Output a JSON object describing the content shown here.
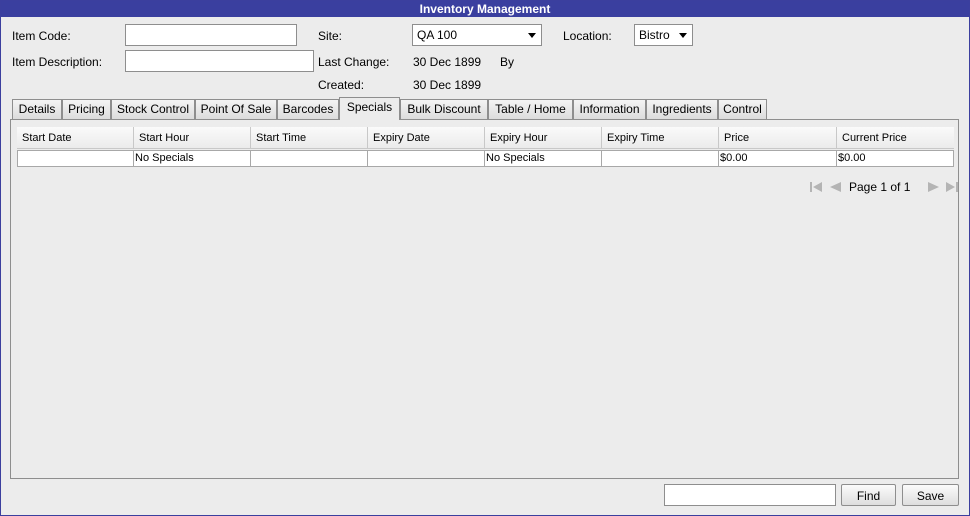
{
  "window": {
    "title": "Inventory Management"
  },
  "form": {
    "item_code_label": "Item Code:",
    "item_code_value": "",
    "item_description_label": "Item Description:",
    "item_description_value": "",
    "site_label": "Site:",
    "site_value": "QA 100",
    "location_label": "Location:",
    "location_value": "Bistro",
    "last_change_label": "Last Change:",
    "last_change_value": "30 Dec 1899",
    "by_label": "By",
    "created_label": "Created:",
    "created_value": "30 Dec 1899"
  },
  "tabs": [
    {
      "label": "Details"
    },
    {
      "label": "Pricing"
    },
    {
      "label": "Stock Control"
    },
    {
      "label": "Point Of Sale"
    },
    {
      "label": "Barcodes"
    },
    {
      "label": "Specials",
      "active": true
    },
    {
      "label": "Bulk Discount"
    },
    {
      "label": "Table / Home"
    },
    {
      "label": "Information"
    },
    {
      "label": "Ingredients"
    },
    {
      "label": "Control"
    }
  ],
  "specials_table": {
    "columns": [
      "Start Date",
      "Start Hour",
      "Start Time",
      "Expiry Date",
      "Expiry Hour",
      "Expiry Time",
      "Price",
      "Current Price"
    ],
    "rows": [
      [
        "",
        "No Specials",
        "",
        "",
        "No Specials",
        "",
        "$0.00",
        "$0.00"
      ]
    ]
  },
  "pager": {
    "text": "Page 1 of 1"
  },
  "footer": {
    "find_value": "",
    "find_label": "Find",
    "save_label": "Save"
  },
  "colors": {
    "titlebar": "#3a3f9f",
    "background": "#ececec"
  }
}
